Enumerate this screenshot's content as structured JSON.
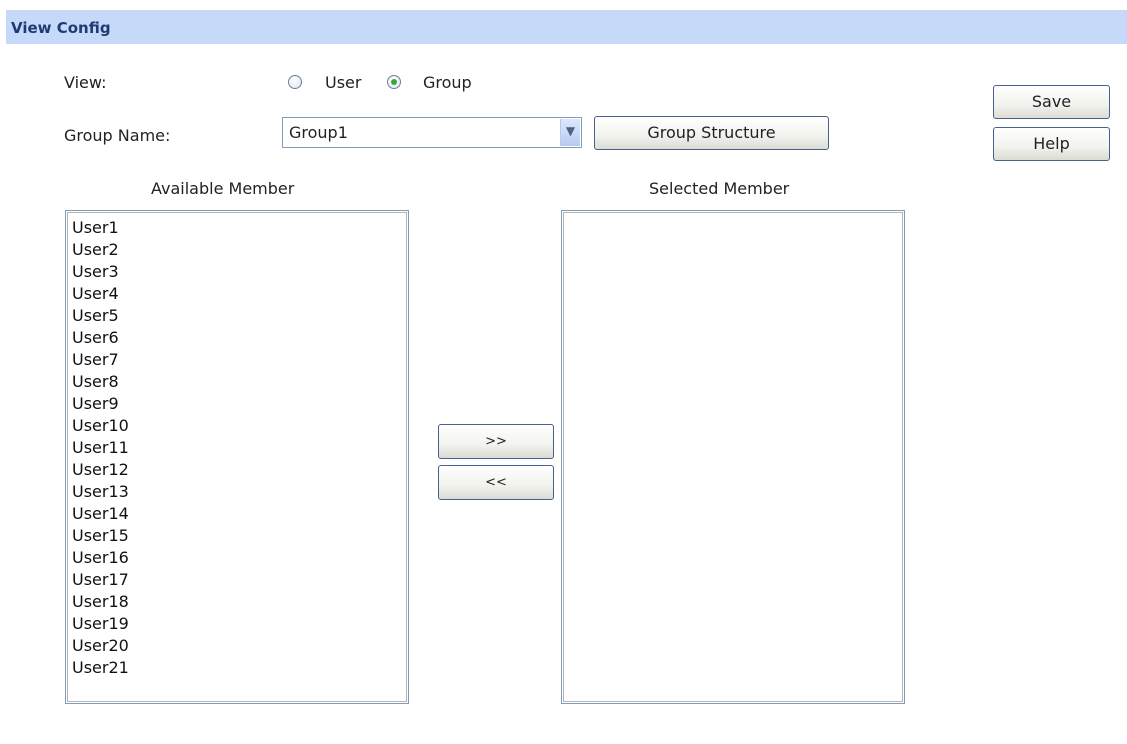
{
  "header": {
    "title": "View Config"
  },
  "view": {
    "label": "View:",
    "options": [
      {
        "label": "User",
        "selected": false
      },
      {
        "label": "Group",
        "selected": true
      }
    ]
  },
  "group_name": {
    "label": "Group Name:",
    "value": "Group1"
  },
  "buttons": {
    "group_structure": "Group Structure",
    "save": "Save",
    "help": "Help",
    "add": ">>",
    "remove": "<<"
  },
  "available": {
    "heading": "Available Member",
    "items": [
      "User1",
      "User2",
      "User3",
      "User4",
      "User5",
      "User6",
      "User7",
      "User8",
      "User9",
      "User10",
      "User11",
      "User12",
      "User13",
      "User14",
      "User15",
      "User16",
      "User17",
      "User18",
      "User19",
      "User20",
      "User21"
    ]
  },
  "selected": {
    "heading": "Selected Member",
    "items": []
  },
  "colors": {
    "header_bg": "#c7d9f8",
    "header_text": "#1d3c74",
    "radio_checked": "#3aa33a",
    "button_border": "#45628c"
  }
}
